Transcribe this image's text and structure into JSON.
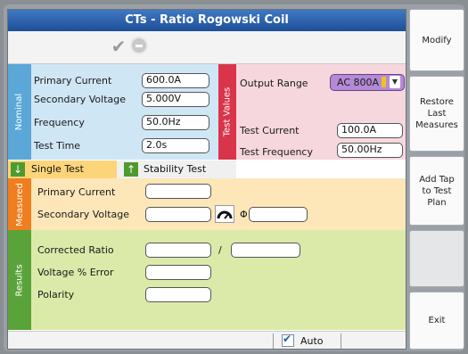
{
  "window": {
    "title": "CTs - Ratio Rogowski Coil"
  },
  "toolbar": {
    "icons": [
      "check-icon",
      "cancel-icon"
    ]
  },
  "nominal": {
    "tab_label": "Nominal",
    "primary_current": {
      "label": "Primary Current",
      "value": "600.0A"
    },
    "secondary_voltage": {
      "label": "Secondary Voltage",
      "value": "5.000V"
    },
    "frequency": {
      "label": "Frequency",
      "value": "50.0Hz"
    },
    "test_time": {
      "label": "Test Time",
      "value": "2.0s"
    }
  },
  "test_values": {
    "tab_label": "Test Values",
    "output_range": {
      "label": "Output Range",
      "value": "AC 800A"
    },
    "test_current": {
      "label": "Test Current",
      "value": "100.0A"
    },
    "test_frequency": {
      "label": "Test Frequency",
      "value": "50.00Hz"
    }
  },
  "tabs": [
    {
      "label": "Single Test",
      "icon": "arrow-down-icon"
    },
    {
      "label": "Stability Test",
      "icon": "arrow-up-icon"
    }
  ],
  "measured": {
    "tab_label": "Measured",
    "primary_current": {
      "label": "Primary Current",
      "value": ""
    },
    "secondary_voltage": {
      "label": "Secondary Voltage",
      "value": ""
    },
    "phase_symbol": "Φ",
    "phase_value": ""
  },
  "results": {
    "tab_label": "Results",
    "corrected_ratio": {
      "label": "Corrected Ratio",
      "separator": "/"
    },
    "voltage_error": {
      "label": "Voltage % Error"
    },
    "polarity": {
      "label": "Polarity"
    }
  },
  "statusbar": {
    "auto_label": "Auto",
    "auto_checked": true
  },
  "sidebar": {
    "modify": "Modify",
    "restore": "Restore Last Measures",
    "add_tap": "Add Tap to Test Plan",
    "exit": "Exit"
  },
  "colors": {
    "title_blue": "#1e4f98",
    "nominal_bg": "#cfe6f5",
    "nominal_tab": "#5aa7d8",
    "test_values_tab": "#d9344a",
    "test_values_bg": "#f6d7dd",
    "measured_tab": "#f07d1e",
    "measured_bg": "#fde7b9",
    "results_tab": "#5aa33a",
    "results_bg": "#dbeaa9"
  }
}
